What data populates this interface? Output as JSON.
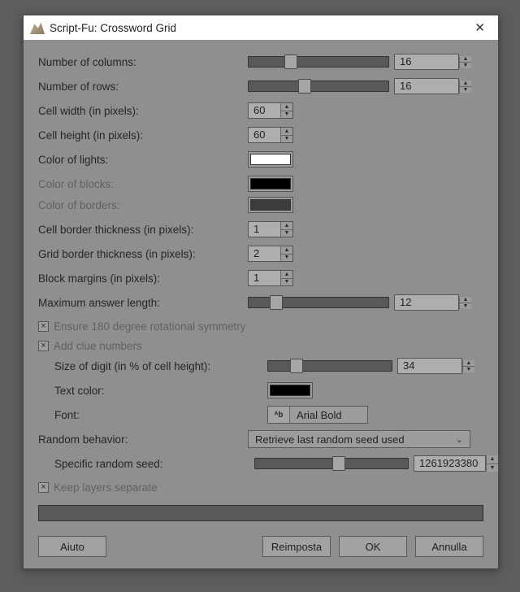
{
  "title": "Script-Fu: Crossword Grid",
  "labels": {
    "columns": "Number of columns:",
    "rows": "Number of rows:",
    "cell_width": "Cell width (in pixels):",
    "cell_height": "Cell height (in pixels):",
    "color_lights": "Color of lights:",
    "color_blocks": "Color of blocks:",
    "color_borders": "Color of borders:",
    "cell_border_thick": "Cell border thickness (in pixels):",
    "grid_border_thick": "Grid border thickness (in pixels):",
    "block_margins": "Block margins (in pixels):",
    "max_answer": "Maximum answer length:",
    "ensure_sym": "Ensure 180 degree rotational symmetry",
    "add_clues": "Add clue numbers",
    "digit_pct": "Size of digit (in % of cell height):",
    "text_color": "Text color:",
    "font": "Font:",
    "random_behavior": "Random behavior:",
    "specific_seed": "Specific random seed:",
    "keep_layers": "Keep layers separate"
  },
  "values": {
    "columns": "16",
    "rows": "16",
    "cell_width": "60",
    "cell_height": "60",
    "cell_border_thick": "1",
    "grid_border_thick": "2",
    "block_margins": "1",
    "max_answer": "12",
    "digit_pct": "34",
    "font_name": "Arial Bold",
    "dropdown": "Retrieve last random seed used",
    "seed": "1261923380"
  },
  "colors": {
    "lights": "#ffffff",
    "blocks": "#000000",
    "borders": "#3c3c3c",
    "text": "#000000"
  },
  "slider_pct": {
    "columns": 30,
    "rows": 40,
    "max_answer": 20,
    "digit_pct": 23,
    "seed": 55
  },
  "checks": {
    "ensure_sym": true,
    "add_clues": true,
    "keep_layers": true
  },
  "buttons": {
    "help": "Aiuto",
    "reset": "Reimposta",
    "ok": "OK",
    "cancel": "Annulla"
  }
}
